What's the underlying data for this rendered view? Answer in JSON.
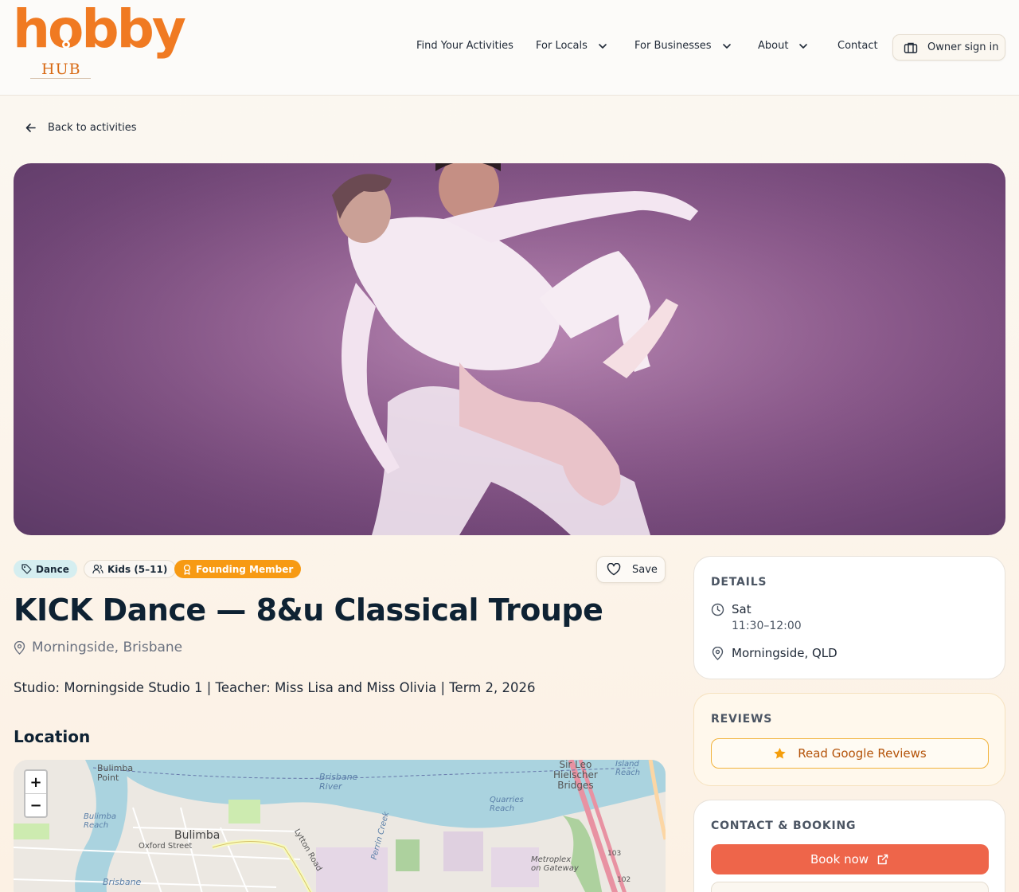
{
  "brand": {
    "logo_word": "hobby",
    "logo_sub": "HUB",
    "accent": "#f07a22"
  },
  "nav": {
    "items": [
      "Find Your Activities",
      "For Locals",
      "For Businesses",
      "About",
      "Contact"
    ],
    "owner_sign_in": "Owner sign in"
  },
  "back_link": "Back to activities",
  "tags": {
    "category": "Dance",
    "age": "Kids (5–11)",
    "badge": "Founding Member"
  },
  "save_label": "Save",
  "activity": {
    "title": "KICK Dance — 8&u Classical Troupe",
    "location": "Morningside, Brisbane",
    "description": "Studio: Morningside Studio 1 | Teacher: Miss Lisa and Miss Olivia | Term 2, 2026"
  },
  "location_heading": "Location",
  "map": {
    "zoom_in": "+",
    "zoom_out": "−",
    "labels": {
      "bulimba_point": "Bulimba\nPoint",
      "brisbane_river": "Brisbane\nRiver",
      "bulimba_reach": "Bulimba\nReach",
      "bulimba": "Bulimba",
      "oxford_street": "Oxford Street",
      "lytton_road": "Lytton Road",
      "perrin_creek": "Perrin Creek",
      "quarries_reach": "Quarries\nReach",
      "sir_leo": "Sir Leo\nHielscher\nBridges",
      "island_reach": "Island\nReach",
      "metroplex": "Metroplex\non Gateway",
      "brisbane": "Brisbane",
      "road_103": "103",
      "road_102": "102"
    }
  },
  "details": {
    "heading": "DETAILS",
    "day": "Sat",
    "time": "11:30–12:00",
    "place": "Morningside, QLD"
  },
  "reviews": {
    "heading": "REVIEWS",
    "button": "Read Google Reviews"
  },
  "contact": {
    "heading": "CONTACT & BOOKING",
    "book_now": "Book now"
  }
}
